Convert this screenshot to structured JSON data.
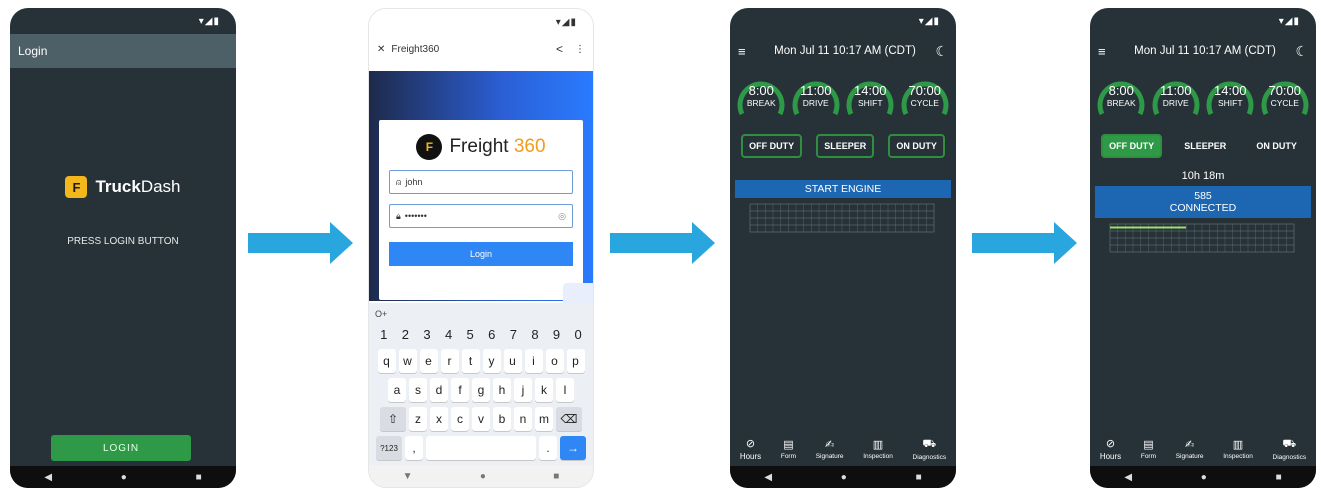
{
  "status_icons": "▾◢▮",
  "screen1": {
    "appbar_title": "Login",
    "logo_bold": "Truck",
    "logo_light": "Dash",
    "logo_mark": "F",
    "prompt": "PRESS LOGIN BUTTON",
    "login_button": "LOGIN"
  },
  "screen2": {
    "close_glyph": "✕",
    "title": "Freight360",
    "share_glyph": "<",
    "more_glyph": "⋮",
    "brand_word": "Freight",
    "brand_num": "360",
    "brand_mark": "F",
    "username_value": "john",
    "password_value": "•••••••",
    "login_button": "Login",
    "key_glyph": "O+",
    "keyboard": {
      "numbers": [
        "1",
        "2",
        "3",
        "4",
        "5",
        "6",
        "7",
        "8",
        "9",
        "0"
      ],
      "row1": [
        "q",
        "w",
        "e",
        "r",
        "t",
        "y",
        "u",
        "i",
        "o",
        "p"
      ],
      "row2": [
        "a",
        "s",
        "d",
        "f",
        "g",
        "h",
        "j",
        "k",
        "l"
      ],
      "row3": [
        "z",
        "x",
        "c",
        "v",
        "b",
        "n",
        "m"
      ],
      "shift": "⇧",
      "backspace": "⌫",
      "symbols": "?123",
      "comma": ",",
      "period": ".",
      "enter": "→"
    }
  },
  "eld_header": {
    "menu_glyph": "≡",
    "title": "Mon Jul 11 10:17 AM (CDT)",
    "moon_glyph": "☾"
  },
  "gauges": [
    {
      "value": "8:00",
      "label": "BREAK"
    },
    {
      "value": "11:00",
      "label": "DRIVE"
    },
    {
      "value": "14:00",
      "label": "SHIFT"
    },
    {
      "value": "70:00",
      "label": "CYCLE"
    }
  ],
  "duty": {
    "off": "OFF DUTY",
    "sleeper": "SLEEPER",
    "on": "ON DUTY"
  },
  "screen3": {
    "start_engine": "START ENGINE"
  },
  "screen4": {
    "timer": "10h 18m",
    "unit": "585",
    "connected": "CONNECTED"
  },
  "bottom_nav": [
    {
      "icon": "⊘",
      "label": "Hours"
    },
    {
      "icon": "▤",
      "label": "Form"
    },
    {
      "icon": "✍",
      "label": "Signature"
    },
    {
      "icon": "▥",
      "label": "Inspection"
    },
    {
      "icon": "⛟",
      "label": "Diagnostics"
    }
  ],
  "android_nav": {
    "back": "◀",
    "home": "●",
    "recent": "■"
  },
  "colors": {
    "phone_bg": "#263238",
    "green": "#2e9a47",
    "blue_bar": "#1d67b2",
    "arrow": "#2aa6de",
    "brand_orange": "#f39b1a"
  }
}
